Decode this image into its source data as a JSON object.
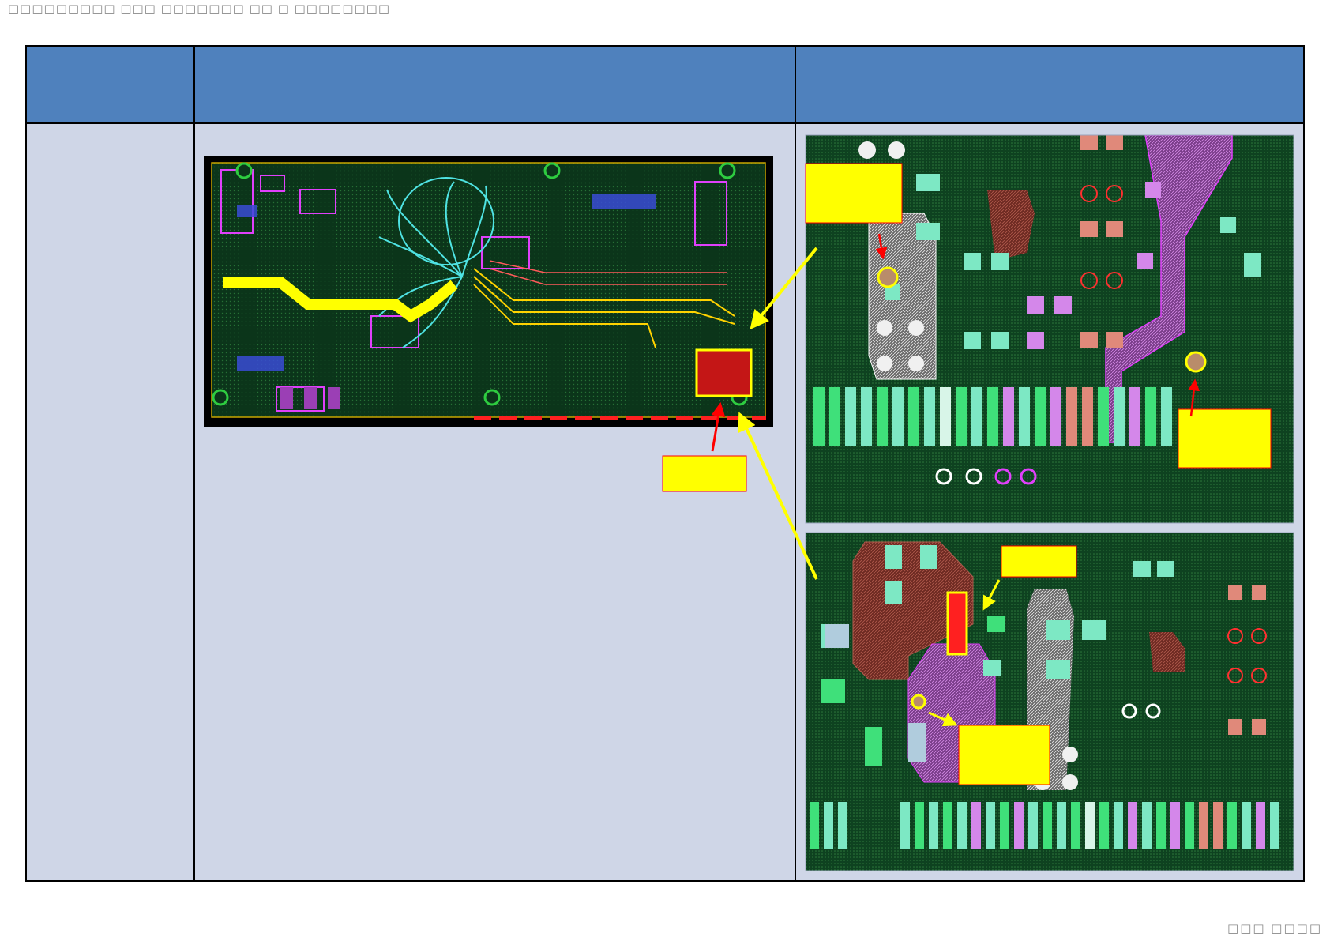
{
  "header": {
    "title": "□□□□□□□□□ □□□ □□□□□□□ □□ □ □□□□□□□□"
  },
  "table": {
    "columns": [
      "",
      "",
      ""
    ],
    "row_label": ""
  },
  "callouts": {
    "board_label": "",
    "top_left_label": "",
    "top_right_label": "",
    "bottom_top_label": "",
    "bottom_mid_label": ""
  },
  "footer": {
    "page_number": "□□□ □□□□"
  },
  "colors": {
    "header_blue": "#4f81bd",
    "body_fill": "#cfd6e7",
    "highlight_yellow": "#ffff00",
    "arrow_red": "#ff0000",
    "pcb_green": "#0b3d1b"
  }
}
